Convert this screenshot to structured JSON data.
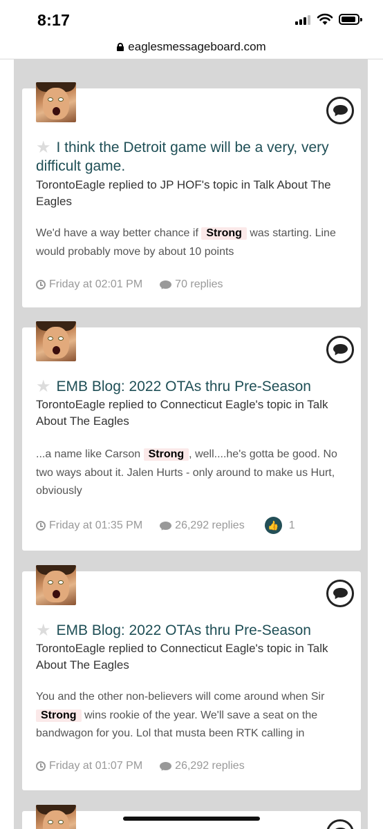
{
  "status_bar": {
    "time": "8:17"
  },
  "browser": {
    "url": "eaglesmessageboard.com"
  },
  "posts": [
    {
      "title": "I think the Detroit game will be a very, very difficult game.",
      "meta": "TorontoEagle replied to JP HOF's topic in Talk About The Eagles",
      "snippet_before": "We'd have a way better chance if ",
      "highlight": "Strong",
      "snippet_after": " was starting. Line would probably move by about 10 points",
      "time": "Friday at 02:01 PM",
      "replies": "70 replies"
    },
    {
      "title": "EMB Blog: 2022 OTAs thru Pre-Season",
      "meta": "TorontoEagle replied to Connecticut Eagle's topic in Talk About The Eagles",
      "snippet_before": "...a name like Carson ",
      "highlight": "Strong",
      "snippet_after": ", well....he's gotta be good. No two ways about it. Jalen Hurts - only around to make us Hurt, obviously",
      "time": "Friday at 01:35 PM",
      "replies": "26,292 replies",
      "likes": "1"
    },
    {
      "title": "EMB Blog: 2022 OTAs thru Pre-Season",
      "meta": "TorontoEagle replied to Connecticut Eagle's topic in Talk About The Eagles",
      "snippet_before": "You and the other non-believers will come around when Sir ",
      "highlight": "Strong",
      "snippet_after": " wins rookie of the year. We'll save a seat on the bandwagon for you. Lol that musta been RTK calling in",
      "time": "Friday at 01:07 PM",
      "replies": "26,292 replies"
    }
  ]
}
